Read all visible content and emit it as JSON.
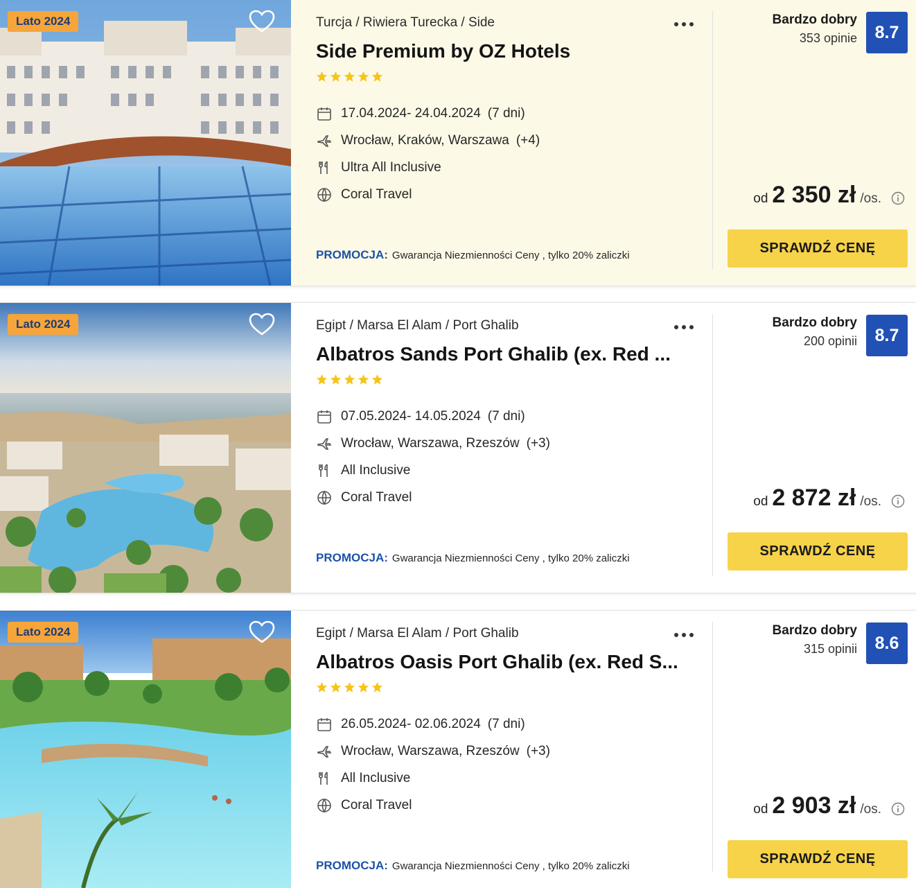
{
  "offers": [
    {
      "season": "Lato 2024",
      "location": "Turcja / Riwiera Turecka / Side",
      "title": "Side Premium by OZ Hotels",
      "stars": 5,
      "dates": "17.04.2024- 24.04.2024",
      "duration": "(7 dni)",
      "airports": "Wrocław, Kraków, Warszawa",
      "airports_more": "(+4)",
      "board": "Ultra All Inclusive",
      "operator": "Coral Travel",
      "promo_label": "PROMOCJA:",
      "promo_text": "Gwarancja Niezmienności Ceny , tylko 20% zaliczki",
      "rating_word": "Bardzo dobry",
      "reviews": "353 opinie",
      "score": "8.7",
      "price_prefix": "od",
      "price": "2 350 zł",
      "price_suffix": "/os.",
      "cta": "SPRAWDŹ CENĘ"
    },
    {
      "season": "Lato 2024",
      "location": "Egipt / Marsa El Alam / Port Ghalib",
      "title": "Albatros Sands Port Ghalib (ex. Red ...",
      "stars": 5,
      "dates": "07.05.2024- 14.05.2024",
      "duration": "(7 dni)",
      "airports": "Wrocław, Warszawa, Rzeszów",
      "airports_more": "(+3)",
      "board": "All Inclusive",
      "operator": "Coral Travel",
      "promo_label": "PROMOCJA:",
      "promo_text": "Gwarancja Niezmienności Ceny , tylko 20% zaliczki",
      "rating_word": "Bardzo dobry",
      "reviews": "200 opinii",
      "score": "8.7",
      "price_prefix": "od",
      "price": "2 872 zł",
      "price_suffix": "/os.",
      "cta": "SPRAWDŹ CENĘ"
    },
    {
      "season": "Lato 2024",
      "location": "Egipt / Marsa El Alam / Port Ghalib",
      "title": "Albatros Oasis Port Ghalib (ex. Red S...",
      "stars": 5,
      "dates": "26.05.2024- 02.06.2024",
      "duration": "(7 dni)",
      "airports": "Wrocław, Warszawa, Rzeszów",
      "airports_more": "(+3)",
      "board": "All Inclusive",
      "operator": "Coral Travel",
      "promo_label": "PROMOCJA:",
      "promo_text": "Gwarancja Niezmienności Ceny , tylko 20% zaliczki",
      "rating_word": "Bardzo dobry",
      "reviews": "315 opinii",
      "score": "8.6",
      "price_prefix": "od",
      "price": "2 903 zł",
      "price_suffix": "/os.",
      "cta": "SPRAWDŹ CENĘ"
    }
  ],
  "colors": {
    "badge": "#f6a53a",
    "badge_text": "#1d3c78",
    "score_bg": "#2251b5",
    "cta_bg": "#f7d34a",
    "promo_label": "#1b52a8",
    "star": "#f5c518",
    "highlight_bg": "#fdf9e7"
  },
  "icons": [
    "heart-icon",
    "more-dots-icon",
    "star-icon",
    "calendar-icon",
    "plane-icon",
    "cutlery-icon",
    "globe-icon",
    "info-icon"
  ]
}
